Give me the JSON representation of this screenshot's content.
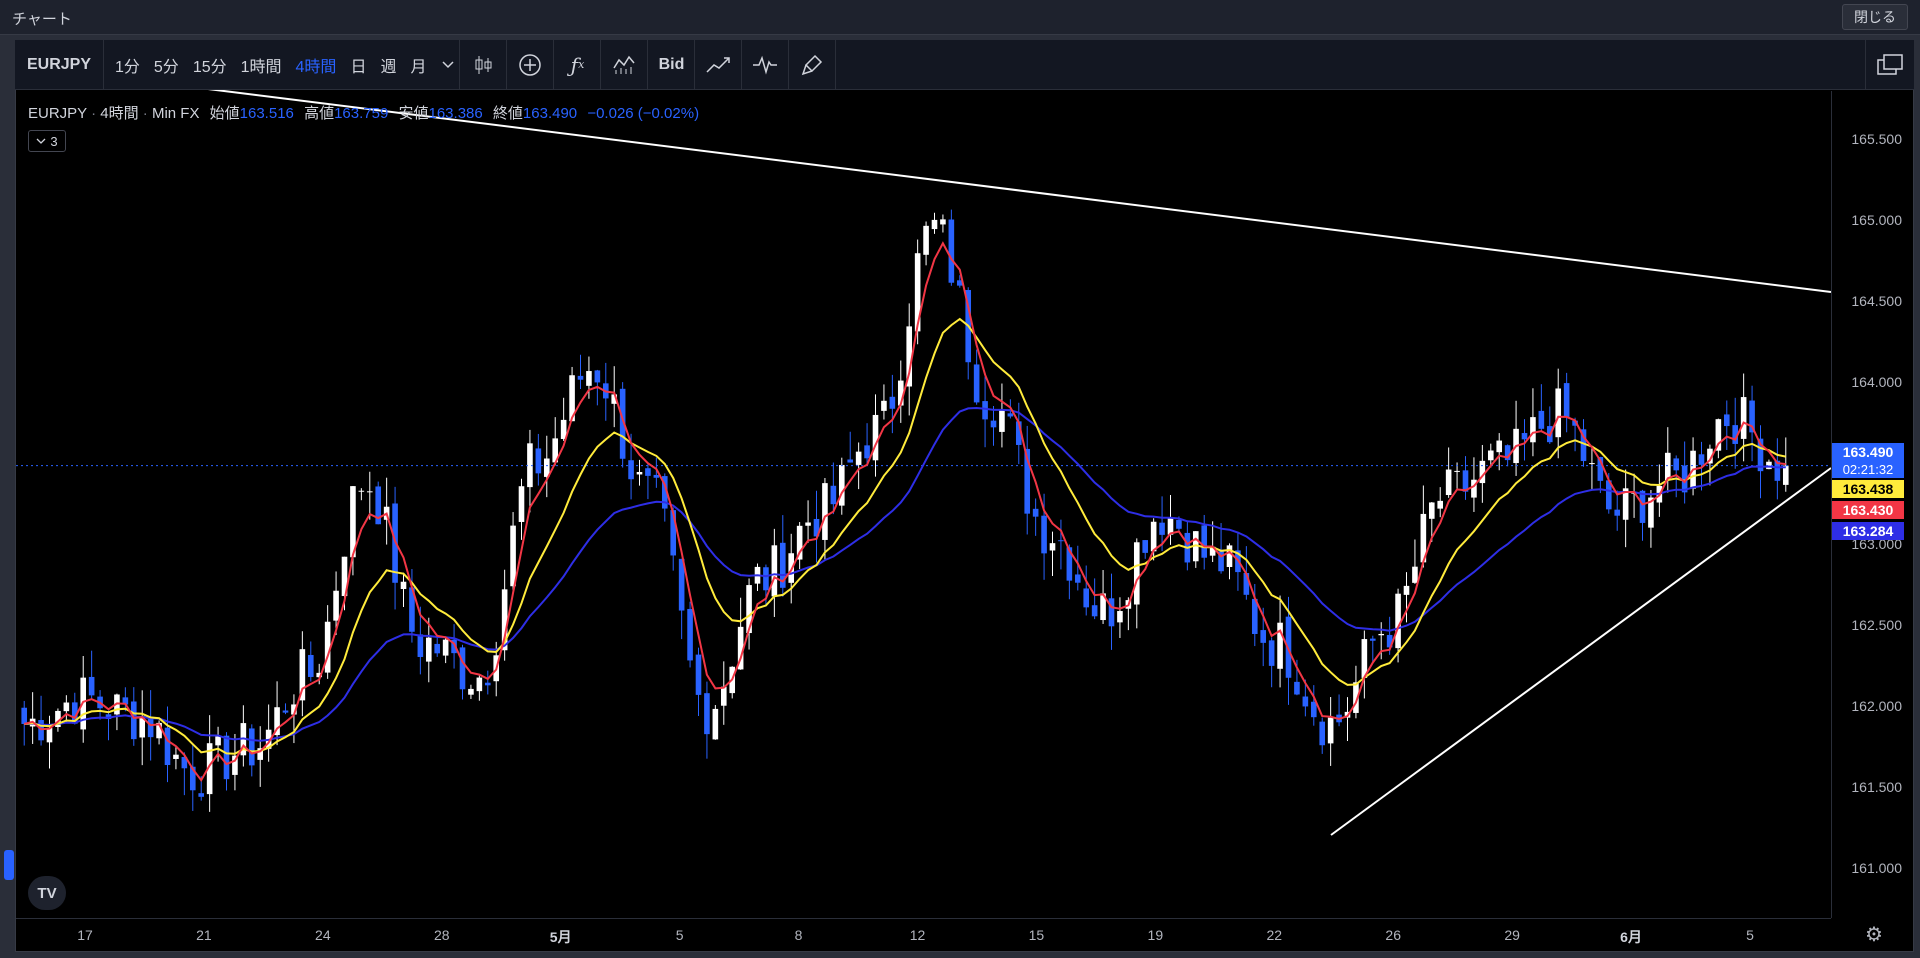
{
  "window": {
    "title": "チャート",
    "close_label": "閉じる"
  },
  "toolbar": {
    "symbol": "EURJPY",
    "intervals": [
      {
        "label": "1分",
        "active": false
      },
      {
        "label": "5分",
        "active": false
      },
      {
        "label": "15分",
        "active": false
      },
      {
        "label": "1時間",
        "active": false
      },
      {
        "label": "4時間",
        "active": true
      },
      {
        "label": "日",
        "active": false
      },
      {
        "label": "週",
        "active": false
      },
      {
        "label": "月",
        "active": false
      }
    ],
    "icons": [
      "chevron-down-icon",
      "candlestick-type-icon",
      "add-compare-icon",
      "indicators-icon",
      "templates-icon"
    ],
    "bid_label": "Bid",
    "icons_after_bid": [
      "line-tool-icon",
      "replay-icon",
      "brush-icon"
    ],
    "right_icon": "fullscreen-icon"
  },
  "legend": {
    "symbol": "EURJPY",
    "interval": "4時間",
    "source": "Min FX",
    "open_label": "始値",
    "open": "163.516",
    "high_label": "高値",
    "high": "163.759",
    "low_label": "安値",
    "low": "163.386",
    "close_label": "終値",
    "close": "163.490",
    "change": "−0.026 (−0.02%)",
    "collapsed_count": "3"
  },
  "colors": {
    "bull": "#ffffff",
    "bear": "#2962ff",
    "ma_fast": "#f23645",
    "ma_mid": "#ffeb3b",
    "ma_slow": "#2e2ee6",
    "accent": "#2962ff"
  },
  "price_axis": {
    "labels": [
      "165.500",
      "165.000",
      "164.500",
      "164.000",
      "163.500",
      "163.000",
      "162.500",
      "162.000",
      "161.500",
      "161.000"
    ],
    "tags": [
      {
        "value": "163.490",
        "sub": "02:21:32",
        "bg": "#2962ff",
        "fg": "#ffffff"
      },
      {
        "value": "163.438",
        "bg": "#ffeb3b",
        "fg": "#000000"
      },
      {
        "value": "163.430",
        "bg": "#f23645",
        "fg": "#ffffff"
      },
      {
        "value": "163.284",
        "bg": "#2e2ee6",
        "fg": "#ffffff"
      }
    ]
  },
  "time_axis": {
    "labels": [
      {
        "text": "17",
        "bold": false
      },
      {
        "text": "21",
        "bold": false
      },
      {
        "text": "24",
        "bold": false
      },
      {
        "text": "28",
        "bold": false
      },
      {
        "text": "5月",
        "bold": true
      },
      {
        "text": "5",
        "bold": false
      },
      {
        "text": "8",
        "bold": false
      },
      {
        "text": "12",
        "bold": false
      },
      {
        "text": "15",
        "bold": false
      },
      {
        "text": "19",
        "bold": false
      },
      {
        "text": "22",
        "bold": false
      },
      {
        "text": "26",
        "bold": false
      },
      {
        "text": "29",
        "bold": false
      },
      {
        "text": "6月",
        "bold": true
      },
      {
        "text": "5",
        "bold": false
      }
    ]
  },
  "logo": "TV",
  "chart_data": {
    "type": "candlestick",
    "symbol": "EURJPY",
    "interval": "4時間",
    "ylim": [
      160.7,
      165.8
    ],
    "last_price": 163.49,
    "anchors": [
      [
        161.9,
        "17"
      ],
      [
        162.05,
        ""
      ],
      [
        161.95,
        "21"
      ],
      [
        161.6,
        ""
      ],
      [
        161.75,
        "24"
      ],
      [
        162.2,
        ""
      ],
      [
        163.4,
        "28"
      ],
      [
        162.4,
        ""
      ],
      [
        162.2,
        "5月"
      ],
      [
        163.5,
        ""
      ],
      [
        164.1,
        ""
      ],
      [
        163.3,
        "5"
      ],
      [
        162.0,
        ""
      ],
      [
        162.8,
        "8"
      ],
      [
        163.2,
        ""
      ],
      [
        163.7,
        "12"
      ],
      [
        164.95,
        ""
      ],
      [
        163.9,
        "15"
      ],
      [
        163.1,
        ""
      ],
      [
        162.6,
        "19"
      ],
      [
        163.2,
        ""
      ],
      [
        162.9,
        "22"
      ],
      [
        162.4,
        ""
      ],
      [
        161.9,
        "26"
      ],
      [
        162.5,
        ""
      ],
      [
        163.3,
        ""
      ],
      [
        163.5,
        "29"
      ],
      [
        163.8,
        ""
      ],
      [
        163.2,
        "6月"
      ],
      [
        163.4,
        ""
      ],
      [
        163.8,
        "5"
      ],
      [
        163.49,
        ""
      ]
    ],
    "moving_averages": [
      {
        "name": "MA fast",
        "last": 163.43
      },
      {
        "name": "MA mid",
        "last": 163.438
      },
      {
        "name": "MA slow",
        "last": 163.284
      }
    ],
    "trendlines": [
      {
        "from": [
          "4月中旬",
          165.95
        ],
        "to": [
          "6月5日",
          164.48
        ]
      },
      {
        "from": [
          "5月25日",
          161.1
        ],
        "to": [
          "6月5日",
          163.28
        ]
      }
    ]
  }
}
